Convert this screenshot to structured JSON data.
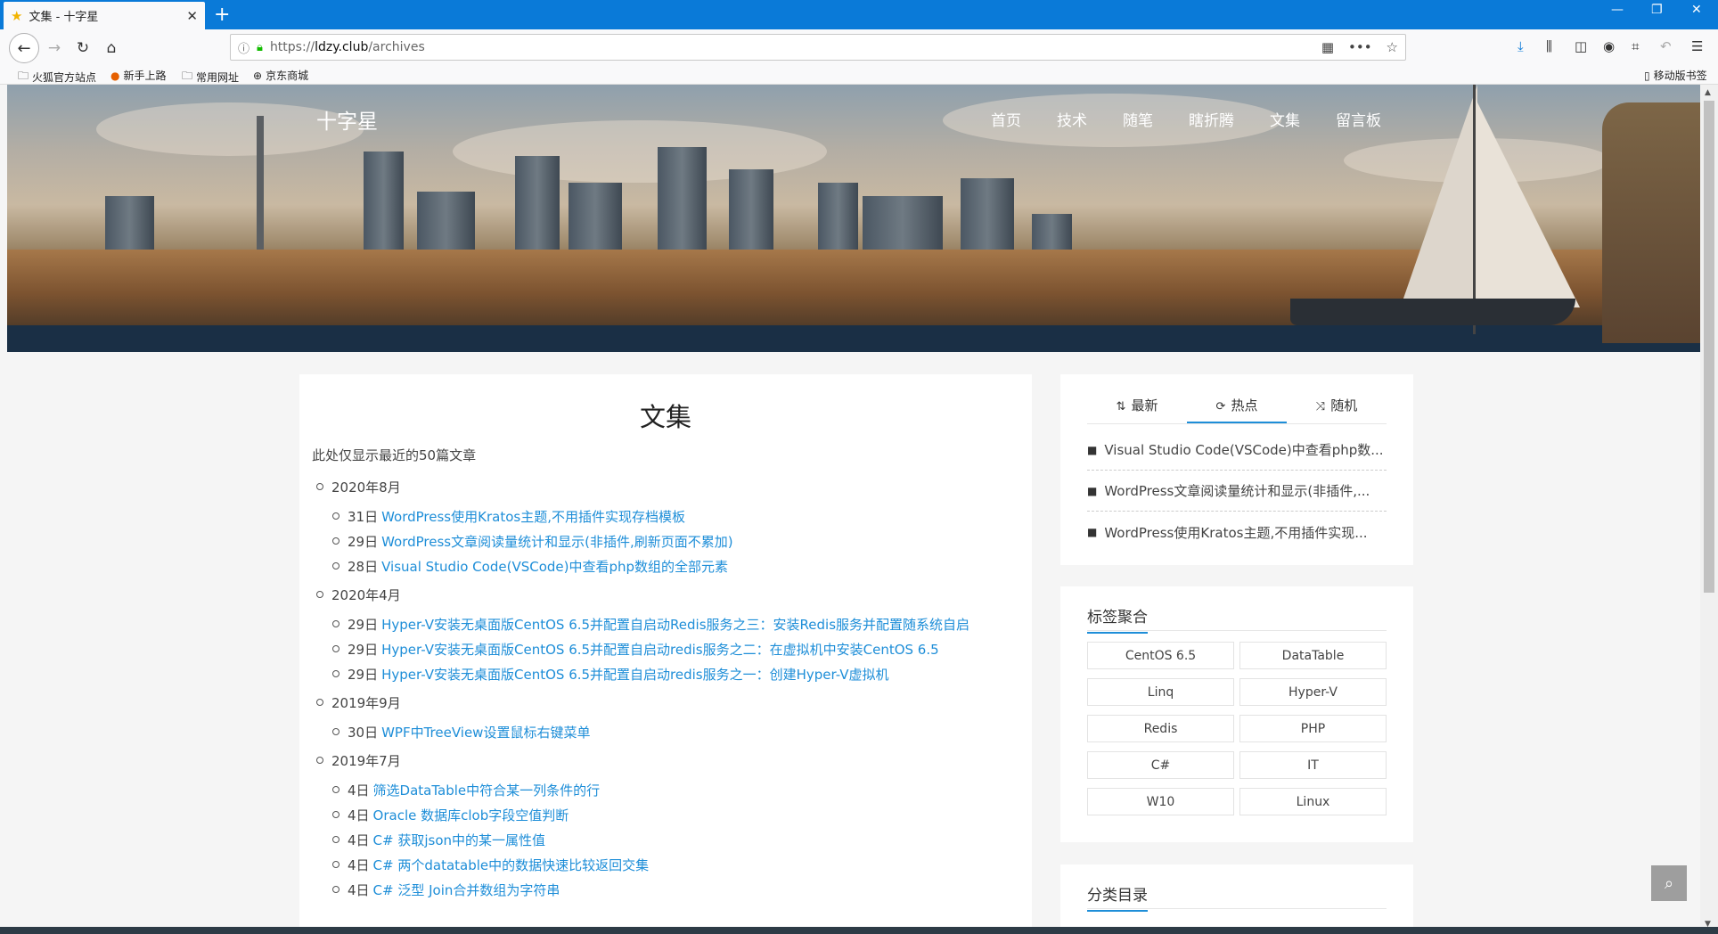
{
  "browser": {
    "tab_title": "文集 - 十字星",
    "url_prefix": "https://",
    "url_domain": "ldzy.club",
    "url_path": "/archives",
    "bookmarks": [
      "火狐官方站点",
      "新手上路",
      "常用网址",
      "京东商城"
    ],
    "mobile_bookmarks": "移动版书签"
  },
  "site": {
    "brand": "十字星",
    "nav": [
      "首页",
      "技术",
      "随笔",
      "瞎折腾",
      "文集",
      "留言板"
    ]
  },
  "article": {
    "title": "文集",
    "note": "此处仅显示最近的50篇文章",
    "months": [
      {
        "label": "2020年8月",
        "posts": [
          {
            "day": "31日",
            "title": "WordPress使用Kratos主题,不用插件实现存档模板"
          },
          {
            "day": "29日",
            "title": "WordPress文章阅读量统计和显示(非插件,刷新页面不累加)"
          },
          {
            "day": "28日",
            "title": "Visual Studio Code(VSCode)中查看php数组的全部元素"
          }
        ]
      },
      {
        "label": "2020年4月",
        "posts": [
          {
            "day": "29日",
            "title": "Hyper-V安装无桌面版CentOS 6.5并配置自启动Redis服务之三：安装Redis服务并配置随系统自启"
          },
          {
            "day": "29日",
            "title": "Hyper-V安装无桌面版CentOS 6.5并配置自启动redis服务之二：在虚拟机中安装CentOS 6.5"
          },
          {
            "day": "29日",
            "title": "Hyper-V安装无桌面版CentOS 6.5并配置自启动redis服务之一：创建Hyper-V虚拟机"
          }
        ]
      },
      {
        "label": "2019年9月",
        "posts": [
          {
            "day": "30日",
            "title": "WPF中TreeView设置鼠标右键菜单"
          }
        ]
      },
      {
        "label": "2019年7月",
        "posts": [
          {
            "day": "4日",
            "title": "筛选DataTable中符合某一列条件的行"
          },
          {
            "day": "4日",
            "title": "Oracle 数据库clob字段空值判断"
          },
          {
            "day": "4日",
            "title": "C# 获取json中的某一属性值"
          },
          {
            "day": "4日",
            "title": "C# 两个datatable中的数据快速比较返回交集"
          },
          {
            "day": "4日",
            "title": "C# 泛型 Join合并数组为字符串"
          }
        ]
      }
    ]
  },
  "sidebar": {
    "tabs": [
      {
        "label": "最新",
        "icon": "sort-icon"
      },
      {
        "label": "热点",
        "icon": "hot-icon"
      },
      {
        "label": "随机",
        "icon": "shuffle-icon"
      }
    ],
    "active_tab": "热点",
    "hot_posts": [
      "Visual Studio Code(VSCode)中查看php数...",
      "WordPress文章阅读量统计和显示(非插件,...",
      "WordPress使用Kratos主题,不用插件实现..."
    ],
    "tags_title": "标签聚合",
    "tags": [
      "CentOS 6.5",
      "DataTable",
      "Linq",
      "Hyper-V",
      "Redis",
      "PHP",
      "C#",
      "IT",
      "W10",
      "Linux"
    ],
    "category_title": "分类目录"
  },
  "colors": {
    "chrome_blue": "#0a7ad8",
    "link": "#1e8ed8"
  }
}
